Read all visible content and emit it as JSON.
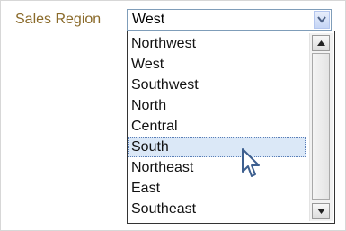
{
  "form": {
    "label": "Sales Region",
    "selected_value": "West"
  },
  "dropdown": {
    "options": [
      "Northwest",
      "West",
      "Southwest",
      "North",
      "Central",
      "South",
      "Northeast",
      "East",
      "Southeast"
    ],
    "hovered_option": "South"
  },
  "icons": {
    "select_arrow": "chevron-down-icon",
    "scroll_up": "scroll-up-icon",
    "scroll_down": "scroll-down-icon",
    "cursor": "mouse-pointer-icon"
  },
  "colors": {
    "label_text": "#8a6a2a",
    "hover_background": "#dbe8f7",
    "select_border": "#7f9db9"
  }
}
